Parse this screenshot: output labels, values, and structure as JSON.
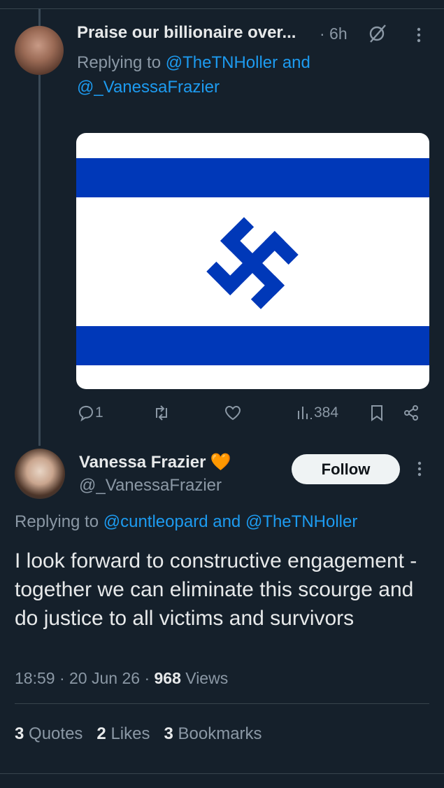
{
  "reply_tweet": {
    "author_name": "Praise our billionaire over...",
    "time": "· 6h",
    "replying_prefix": "Replying to",
    "replying_to_1": "@TheTNHoller",
    "replying_and": "and",
    "replying_to_2": "@_VanessaFrazier",
    "media_icons": [
      "flag-image"
    ],
    "actions": {
      "reply_count": "1",
      "retweet_count": "",
      "like_count": "",
      "views_count": "384"
    }
  },
  "main_tweet": {
    "author_name": "Vanessa Frazier",
    "author_badge": "🧡",
    "handle": "@_VanessaFrazier",
    "follow_label": "Follow",
    "replying_prefix": "Replying to",
    "replying_to_1": "@cuntleopard",
    "replying_and": "and",
    "replying_to_2": "@TheTNHoller",
    "text": "I look forward to constructive engagement - together we can eliminate this scourge and do justice to all victims and survivors",
    "time": "18:59",
    "date": "20 Jun 26",
    "views_count": "968",
    "views_label": "Views",
    "sep": "·",
    "stats": {
      "quotes_count": "3",
      "quotes_label": "Quotes",
      "likes_count": "2",
      "likes_label": "Likes",
      "bookmarks_count": "3",
      "bookmarks_label": "Bookmarks"
    }
  },
  "colors": {
    "background": "#15202b",
    "link": "#1d9bf0",
    "muted": "#8b98a5",
    "flag_blue": "#0038b8"
  }
}
